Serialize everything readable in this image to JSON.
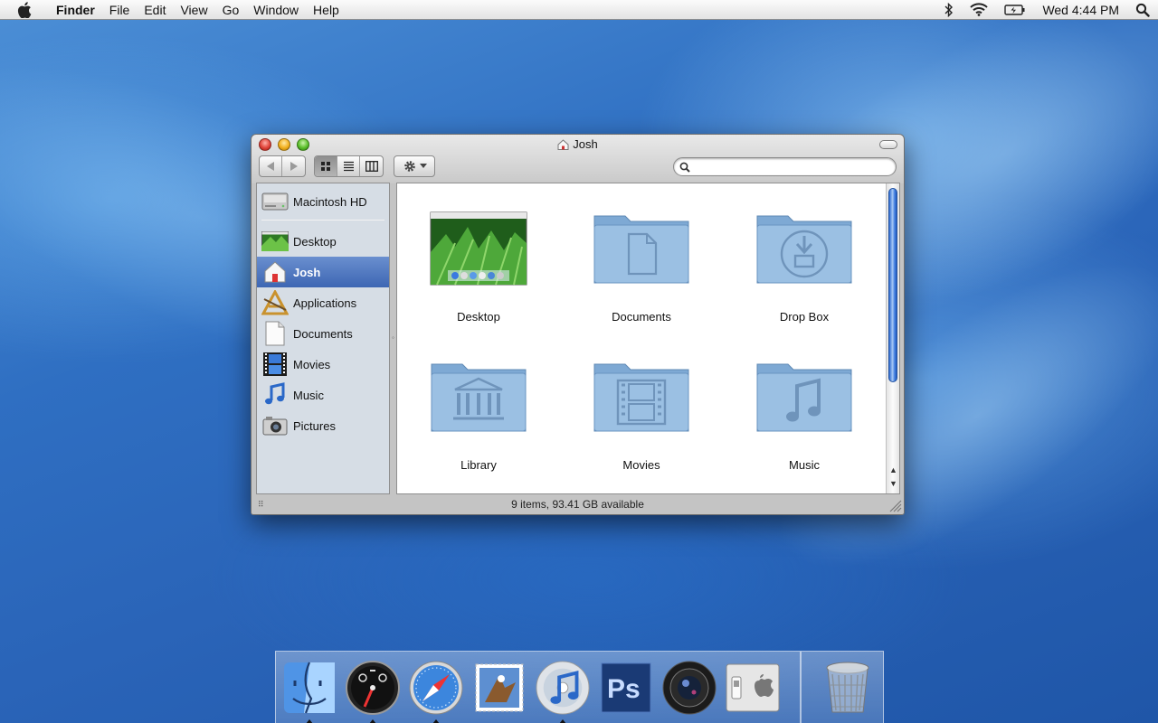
{
  "menubar": {
    "app_name": "Finder",
    "menus": [
      "File",
      "Edit",
      "View",
      "Go",
      "Window",
      "Help"
    ],
    "clock": "Wed 4:44 PM",
    "status_icons": [
      "bluetooth-icon",
      "wifi-icon",
      "battery-icon",
      "spotlight-icon"
    ]
  },
  "window": {
    "title": "Josh",
    "search_placeholder": "",
    "view_modes": [
      "icon-view",
      "list-view",
      "column-view"
    ],
    "active_view": "icon-view",
    "status_text": "9 items, 93.41 GB available"
  },
  "sidebar": {
    "devices": [
      {
        "label": "Macintosh HD",
        "icon": "hard-drive-icon"
      }
    ],
    "places": [
      {
        "label": "Desktop",
        "icon": "desktop-icon"
      },
      {
        "label": "Josh",
        "icon": "home-icon",
        "selected": true
      },
      {
        "label": "Applications",
        "icon": "applications-icon"
      },
      {
        "label": "Documents",
        "icon": "document-icon"
      },
      {
        "label": "Movies",
        "icon": "film-icon"
      },
      {
        "label": "Music",
        "icon": "music-note-icon"
      },
      {
        "label": "Pictures",
        "icon": "camera-icon"
      }
    ]
  },
  "files": [
    {
      "label": "Desktop",
      "icon": "desktop-thumbnail-icon"
    },
    {
      "label": "Documents",
      "icon": "documents-folder-icon"
    },
    {
      "label": "Drop Box",
      "icon": "dropbox-folder-icon"
    },
    {
      "label": "Library",
      "icon": "library-folder-icon"
    },
    {
      "label": "Movies",
      "icon": "movies-folder-icon"
    },
    {
      "label": "Music",
      "icon": "music-folder-icon"
    }
  ],
  "dock": {
    "apps": [
      "Finder",
      "Dashboard",
      "Safari",
      "Mail",
      "iTunes",
      "Photoshop",
      "Aperture",
      "System Preferences"
    ],
    "trash": "Trash"
  },
  "colors": {
    "selection": "#3d66b3",
    "folder_blue": "#8fb6dc",
    "sidebar_bg": "#d6dde5"
  }
}
